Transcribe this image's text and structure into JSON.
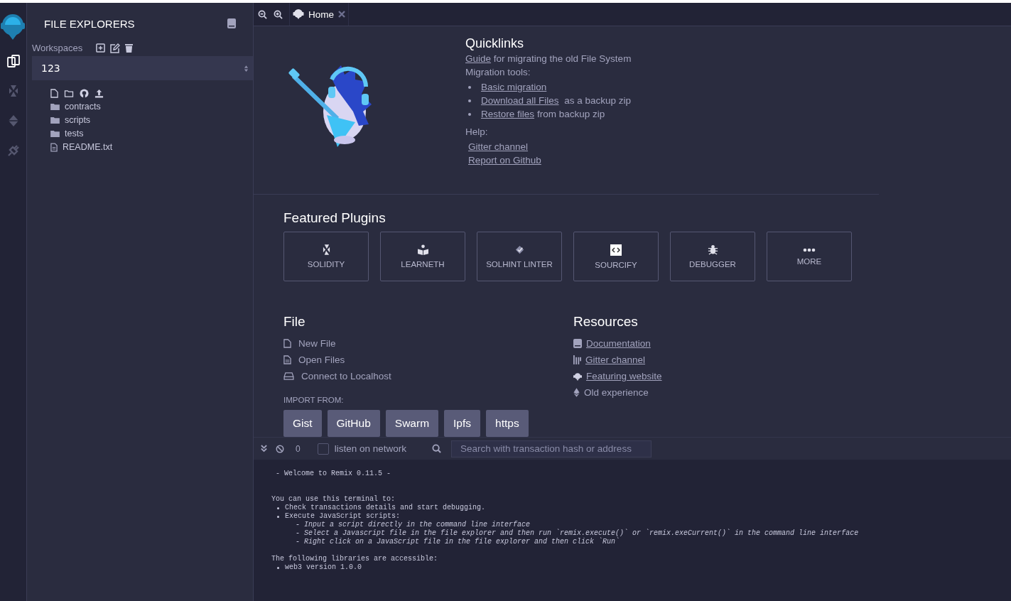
{
  "icon_panel": {
    "items": [
      {
        "kind": "files",
        "selected": true
      },
      {
        "kind": "solidity",
        "selected": false
      },
      {
        "kind": "deploy",
        "selected": false
      },
      {
        "kind": "plugin",
        "selected": false
      }
    ]
  },
  "sidebar": {
    "title": "FILE EXPLORERS",
    "workspaces_label": "Workspaces",
    "workspace": "123",
    "tree": [
      {
        "kind": "folder",
        "name": "contracts"
      },
      {
        "kind": "folder",
        "name": "scripts"
      },
      {
        "kind": "folder",
        "name": "tests"
      },
      {
        "kind": "file",
        "name": "README.txt"
      }
    ]
  },
  "tabs": [
    {
      "label": "Home",
      "selected": true
    }
  ],
  "quicklinks": {
    "title": "Quicklinks",
    "guide_link": "Guide",
    "guide_text": "for migrating the old File System",
    "migration_label": "Migration tools:",
    "migration": [
      {
        "link": "Basic migration"
      },
      {
        "link": "Download all Files",
        "text": " as a backup zip"
      },
      {
        "link": "Restore files",
        "text": "from backup zip"
      }
    ],
    "help_label": "Help:",
    "help_links": [
      "Gitter channel",
      "Report on Github"
    ]
  },
  "featured": {
    "title": "Featured Plugins",
    "plugins": [
      {
        "kind": "solidity",
        "label": "SOLIDITY"
      },
      {
        "kind": "learneth",
        "label": "LEARNETH"
      },
      {
        "kind": "linter",
        "label": "SOLHINT LINTER"
      },
      {
        "kind": "sourcify",
        "label": "SOURCIFY"
      },
      {
        "kind": "debugger",
        "label": "DEBUGGER"
      },
      {
        "kind": "more",
        "label": "MORE"
      }
    ]
  },
  "file": {
    "title": "File",
    "actions": [
      {
        "kind": "new",
        "label": "New File"
      },
      {
        "kind": "open",
        "label": "Open Files"
      },
      {
        "kind": "connect",
        "label": "Connect to Localhost"
      }
    ],
    "import_label": "IMPORT FROM:",
    "import_buttons": [
      "Gist",
      "GitHub",
      "Swarm",
      "Ipfs",
      "https"
    ]
  },
  "resources": {
    "title": "Resources",
    "items": [
      {
        "kind": "book",
        "label": "Documentation",
        "link": true
      },
      {
        "kind": "gitter",
        "label": "Gitter channel",
        "link": true
      },
      {
        "kind": "globe",
        "label": "Featuring website",
        "link": true
      },
      {
        "kind": "eth",
        "label": "Old experience",
        "link": false
      }
    ]
  },
  "terminal_bar": {
    "count": "0",
    "listen_label": "listen on network",
    "listen_checked": false,
    "search_placeholder": "Search with transaction hash or address"
  },
  "terminal": [
    {
      "kind": "welcome",
      "text": "- Welcome to Remix 0.11.5 -"
    },
    {
      "kind": "gap"
    },
    {
      "kind": "plain",
      "text": "You can use this terminal to:"
    },
    {
      "kind": "bullet",
      "text": "Check transactions details and start debugging."
    },
    {
      "kind": "bullet",
      "text": "Execute JavaScript scripts:"
    },
    {
      "kind": "sub",
      "text": "- Input a script directly in the command line interface"
    },
    {
      "kind": "sub",
      "text": "- Select a Javascript file in the file explorer and then run `remix.execute()` or `remix.exeCurrent()` in the command line interface"
    },
    {
      "kind": "sub",
      "text": "- Right click on a JavaScript file in the file explorer and then click `Run`"
    },
    {
      "kind": "gap"
    },
    {
      "kind": "plain",
      "text": "The following libraries are accessible:"
    },
    {
      "kind": "bullet",
      "text": "web3 version 1.0.0"
    }
  ]
}
